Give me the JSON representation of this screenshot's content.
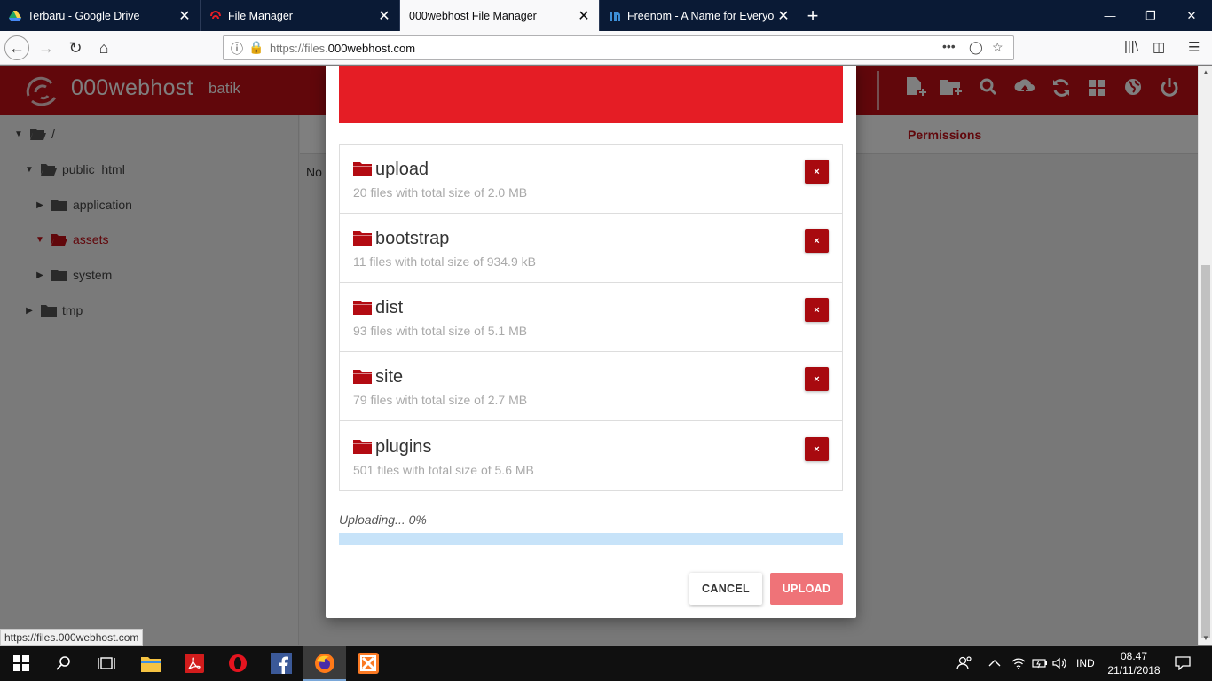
{
  "browser": {
    "tabs": [
      {
        "title": "Terbaru - Google Drive",
        "close": "✕"
      },
      {
        "title": "File Manager",
        "close": "✕"
      },
      {
        "title": "000webhost File Manager",
        "close": "✕"
      },
      {
        "title": "Freenom - A Name for Everyone",
        "close": "✕"
      }
    ],
    "new_tab": "+",
    "url_prefix": "https://files.",
    "url_domain": "000webhost.com",
    "status_url": "https://files.000webhost.com"
  },
  "app": {
    "brand": "000webhost",
    "site_name": "batik",
    "accent_color": "#c20e17",
    "header_icons": [
      "new-file-icon",
      "new-folder-icon",
      "search-icon",
      "upload-icon",
      "refresh-icon",
      "grid-icon",
      "globe-icon",
      "power-icon"
    ]
  },
  "tree": {
    "root": "/",
    "items": [
      {
        "label": "public_html"
      },
      {
        "label": "application"
      },
      {
        "label": "assets"
      },
      {
        "label": "system"
      },
      {
        "label": "tmp"
      }
    ]
  },
  "main": {
    "permissions_header": "Permissions",
    "partial_text": "No"
  },
  "modal": {
    "files": [
      {
        "name": "upload",
        "meta": "20 files with total size of 2.0 MB"
      },
      {
        "name": "bootstrap",
        "meta": "11 files with total size of 934.9 kB"
      },
      {
        "name": "dist",
        "meta": "93 files with total size of 5.1 MB"
      },
      {
        "name": "site",
        "meta": "79 files with total size of 2.7 MB"
      },
      {
        "name": "plugins",
        "meta": "501 files with total size of 5.6 MB"
      }
    ],
    "remove_label": "×",
    "status": "Uploading... 0%",
    "progress": 0,
    "cancel_label": "CANCEL",
    "upload_label": "UPLOAD"
  },
  "taskbar": {
    "language": "IND",
    "time": "08.47",
    "date": "21/11/2018"
  }
}
